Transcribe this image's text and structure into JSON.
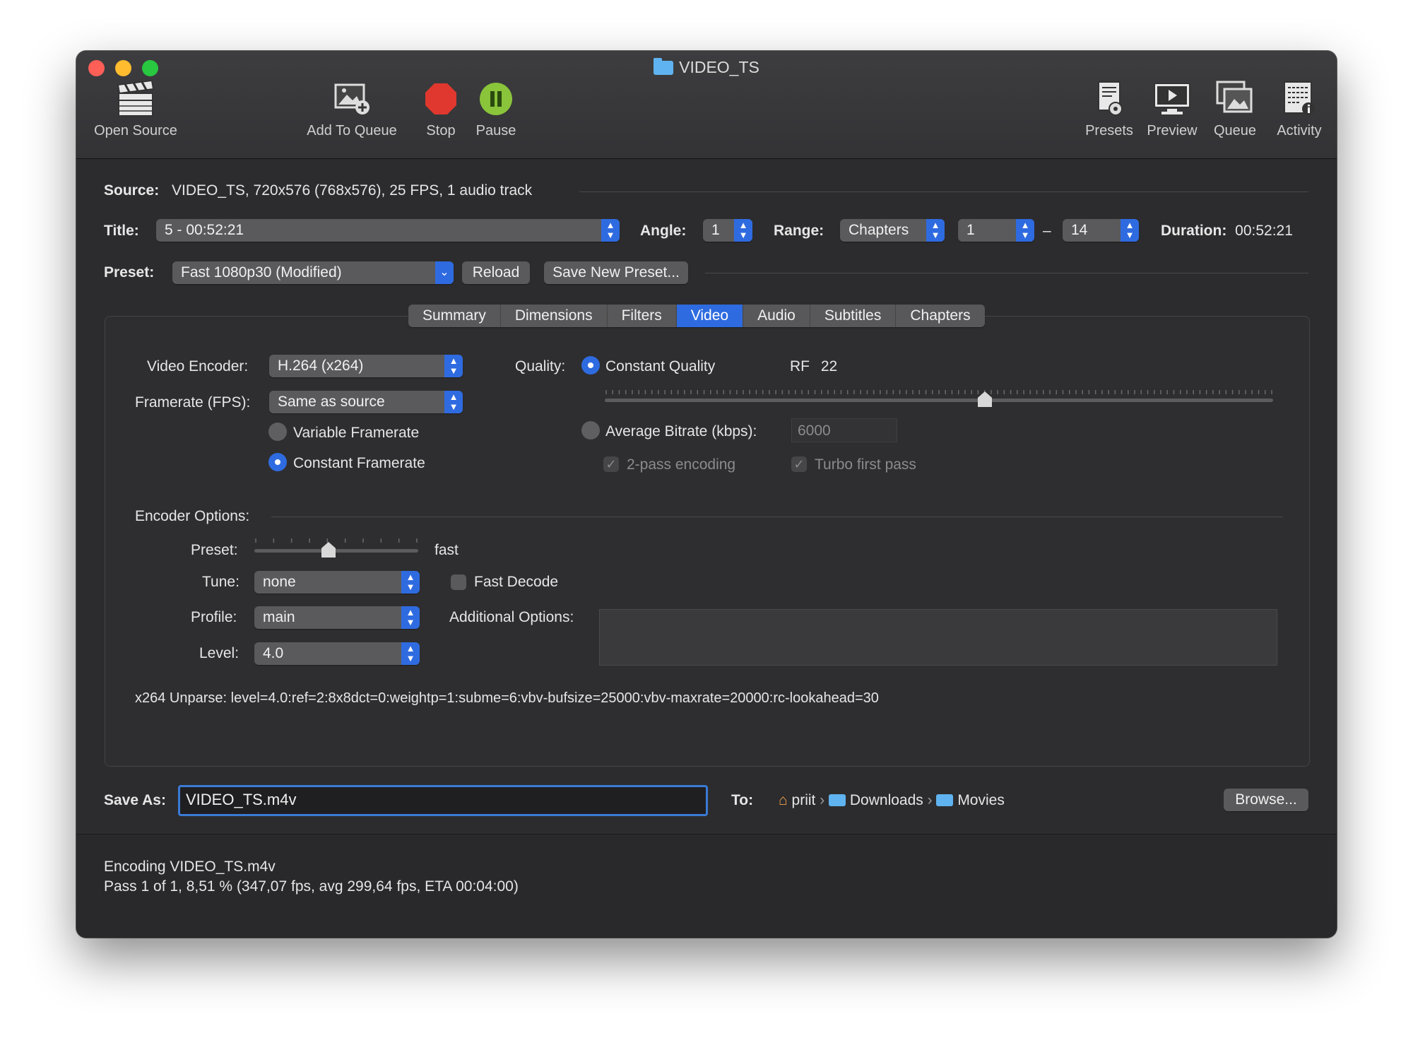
{
  "window": {
    "title": "VIDEO_TS"
  },
  "toolbar": {
    "open_source": "Open Source",
    "add_to_queue": "Add To Queue",
    "stop": "Stop",
    "pause": "Pause",
    "presets": "Presets",
    "preview": "Preview",
    "queue": "Queue",
    "activity": "Activity"
  },
  "source": {
    "label": "Source:",
    "value": "VIDEO_TS, 720x576 (768x576), 25 FPS, 1 audio track"
  },
  "title_row": {
    "title_label": "Title:",
    "title_value": "5 - 00:52:21",
    "angle_label": "Angle:",
    "angle_value": "1",
    "range_label": "Range:",
    "range_mode": "Chapters",
    "range_start": "1",
    "range_sep": "–",
    "range_end": "14",
    "duration_label": "Duration:",
    "duration_value": "00:52:21"
  },
  "preset_row": {
    "label": "Preset:",
    "value": "Fast 1080p30 (Modified)",
    "reload": "Reload",
    "save_new": "Save New Preset..."
  },
  "tabs": [
    "Summary",
    "Dimensions",
    "Filters",
    "Video",
    "Audio",
    "Subtitles",
    "Chapters"
  ],
  "active_tab": "Video",
  "video": {
    "encoder_label": "Video Encoder:",
    "encoder_value": "H.264 (x264)",
    "framerate_label": "Framerate (FPS):",
    "framerate_value": "Same as source",
    "variable_fr": "Variable Framerate",
    "constant_fr": "Constant Framerate",
    "quality_label": "Quality:",
    "constant_quality": "Constant Quality",
    "rf_label": "RF",
    "rf_value": "22",
    "avg_bitrate": "Average Bitrate (kbps):",
    "bitrate_placeholder": "6000",
    "two_pass": "2-pass encoding",
    "turbo": "Turbo first pass"
  },
  "encoder_options": {
    "label": "Encoder Options:",
    "preset_label": "Preset:",
    "preset_value": "fast",
    "tune_label": "Tune:",
    "tune_value": "none",
    "fast_decode": "Fast Decode",
    "profile_label": "Profile:",
    "profile_value": "main",
    "additional_label": "Additional Options:",
    "level_label": "Level:",
    "level_value": "4.0",
    "unparse": "x264 Unparse: level=4.0:ref=2:8x8dct=0:weightp=1:subme=6:vbv-bufsize=25000:vbv-maxrate=20000:rc-lookahead=30"
  },
  "save": {
    "label": "Save As:",
    "filename": "VIDEO_TS.m4v",
    "to_label": "To:",
    "path": [
      "priit",
      "Downloads",
      "Movies"
    ],
    "browse": "Browse..."
  },
  "status": {
    "line1": "Encoding VIDEO_TS.m4v",
    "line2": "Pass 1 of 1, 8,51 % (347,07 fps, avg 299,64 fps, ETA 00:04:00)",
    "progress_percent": 8.51
  },
  "colors": {
    "accent": "#2f6be0",
    "stop": "#e0382e",
    "pause": "#8ac43a"
  }
}
